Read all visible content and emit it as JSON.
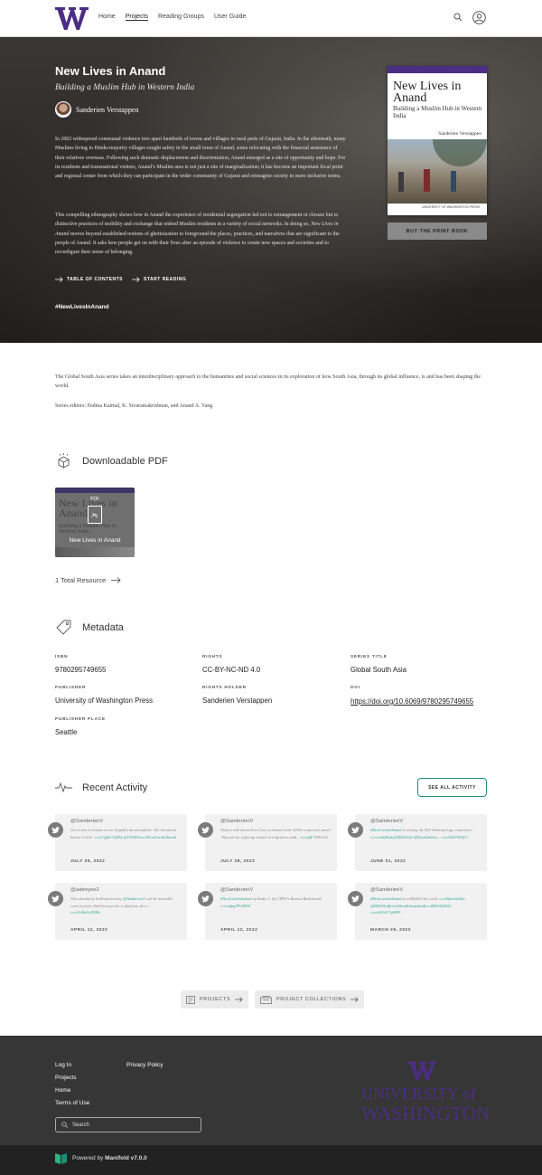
{
  "header": {
    "logo_alt": "W",
    "nav": [
      "Home",
      "Projects",
      "Reading Groups",
      "User Guide"
    ],
    "active_nav": "Projects",
    "icons": [
      "search-icon",
      "user-icon"
    ]
  },
  "hero": {
    "title": "New Lives in Anand",
    "subtitle": "Building a Muslim Hub in Western India",
    "author": "Sanderien Verstappen",
    "description_p1": "In 2002 widespread communal violence tore apart hundreds of towns and villages in rural parts of Gujarat, India. In the aftermath, many Muslims living in Hindu-majority villages sought safety in the small town of Anand, some relocating with the financial assistance of their relatives overseas. Following such dramatic displacement and disorientation, Anand emerged as a site of opportunity and hope. For its residents and transnational visitors, Anand’s Muslim area is not just a site of marginalization; it has become an important focal point and regional center from which they can participate in the wider community of Gujarat and reimagine society in more inclusive terms.",
    "description_p2_a": "This compelling ethnography shows how in Anand the experience of residential segregation led not to estrangement or closure but to distinctive practices of mobility and exchange that embed Muslim residents in a variety of social networks. In doing so, ",
    "description_p2_em": "New Lives in Anand",
    "description_p2_b": " moves beyond established notions of ghettoization to foreground the places, practices, and narratives that are significant to the people of Anand. It asks how people get on with their lives after an episode of violence to create new spaces and societies and to reconfigure their sense of belonging.",
    "toc_label": "TABLE OF CONTENTS",
    "start_label": "START READING",
    "hashtag": "#NewLivesInAnand",
    "buy_label": "BUY THE PRINT BOOK",
    "cover": {
      "title": "New Lives in Anand",
      "subtitle": "Building a Muslim Hub in Western India",
      "author": "Sanderien Verstappen",
      "press": "UNIVERSITY OF WASHINGTON PRESS"
    }
  },
  "series": {
    "text": "The Global South Asia series takes an interdisciplinary approach to the humanities and social sciences in its exploration of how South Asia, through its global influence, is and has been shaping the world.",
    "editors": "Series editors: Padma Kaimal, K. Sivaramakrishnan, and Anand A. Yang"
  },
  "downloads": {
    "heading": "Downloadable PDF",
    "card_type": "PDF",
    "card_title": "New Lives in Anand",
    "total": "1 Total Resource"
  },
  "metadata": {
    "heading": "Metadata",
    "isbn_label": "ISBN",
    "isbn": "9780295749655",
    "rights_label": "RIGHTS",
    "rights": "CC-BY-NC-ND 4.0",
    "series_label": "SERIES TITLE",
    "series_title": "Global South Asia",
    "publisher_label": "PUBLISHER",
    "publisher": "University of Washington Press",
    "holder_label": "RIGHTS HOLDER",
    "holder": "Sanderien Verstappen",
    "doi_label": "DOI",
    "doi": "https://doi.org/10.6069/9780295749655",
    "place_label": "PUBLISHER PLACE",
    "place": "Seattle"
  },
  "activity": {
    "heading": "Recent Activity",
    "see_all": "SEE ALL ACTIVITY",
    "tweets": [
      {
        "user": "@SanderienV",
        "body": "New Lives in Anand is now (legally) downloadable. The download button is here: t.co/Cqfde-JQDrf @UWAPress #NewLivesInAnand",
        "date": "JULY 26, 2022"
      },
      {
        "user": "@SanderienV",
        "body": "Today I talk about New Lives in Anand in the EASA conference panel \"Beyond the suffering subject in migration studi... t.co/pjF P6Evs1b",
        "date": "JULY 28, 2022"
      },
      {
        "user": "@SanderienV",
        "body": "#NewLivesInAnand is visiting the RAI Anthropology conference: t.co/wmQ8xdoff #RAI2022 @RoyalAnthro... t.co/20aVWt4j7v",
        "date": "JUNE 01, 2022"
      },
      {
        "user": "@aatreyee2",
        "body": "This absolutely brilliant book by @SanderienV will be available soon as print. And because she is fabulous, this i... t.co/2sMnGeX5Mv",
        "date": "APRIL 12, 2022"
      },
      {
        "user": "@SanderienV",
        "body": "#NewLivesInAnand op Radio 1, bij VPRO's Bureau Buitenland: t.co/uqbg7PvWEW",
        "date": "APRIL 12, 2022"
      },
      {
        "user": "@SanderienV",
        "body": "#NewLivesInAnand is at BASAS this week: t.co/9fmw5yt5in @BASASofficial #SouthAsianStudies #BASAS2022 t.co/zAUsU7qWK9",
        "date": "MARCH 29, 2022"
      }
    ]
  },
  "bottom_buttons": {
    "projects": "PROJECTS",
    "collections": "PROJECT COLLECTIONS"
  },
  "footer": {
    "col1": [
      "Log In",
      "Projects",
      "Home",
      "Terms of Use"
    ],
    "col2": [
      "Privacy Policy"
    ],
    "search_placeholder": "Search",
    "uw_line1": "UNIVERSITY of",
    "uw_line2": "WASHINGTON",
    "powered_prefix": "Powered by ",
    "powered_brand": "Manifold v7.0.0"
  },
  "colors": {
    "uw_purple": "#4b2e83",
    "accent_green": "#1e8e79",
    "footer_bg": "#363636"
  }
}
